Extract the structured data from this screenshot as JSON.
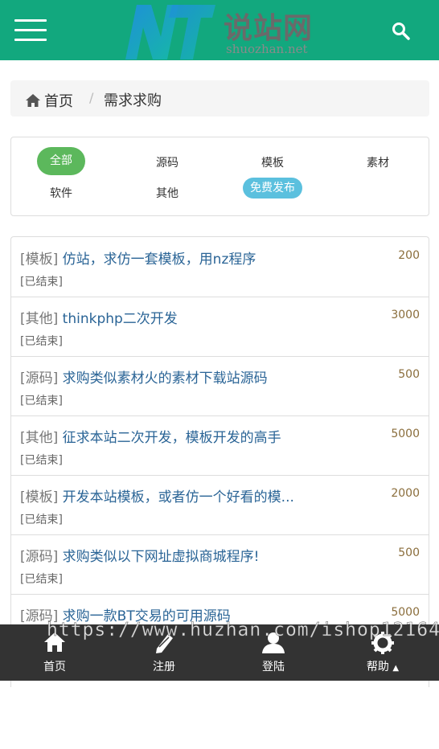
{
  "header": {
    "logo_cn": "说站网",
    "logo_url": "shuozhan.net",
    "brand_color": "#12a87e"
  },
  "breadcrumb": {
    "home": "首页",
    "separator": "/",
    "current": "需求求购"
  },
  "categories": {
    "items": [
      "全部",
      "源码",
      "模板",
      "素材",
      "软件",
      "其他"
    ],
    "publish": "免费发布"
  },
  "demands": [
    {
      "cat": "[模板]",
      "title": "仿站，求仿一套模板，用nz程序",
      "status": "[已结束]",
      "price": "200"
    },
    {
      "cat": "[其他]",
      "title": "thinkphp二次开发",
      "status": "[已结束]",
      "price": "3000"
    },
    {
      "cat": "[源码]",
      "title": "求购类似素材火的素材下载站源码",
      "status": "[已结束]",
      "price": "500"
    },
    {
      "cat": "[其他]",
      "title": "征求本站二次开发，模板开发的高手",
      "status": "[已结束]",
      "price": "5000"
    },
    {
      "cat": "[模板]",
      "title": "开发本站模板，或者仿一个好看的模...",
      "status": "[已结束]",
      "price": "2000"
    },
    {
      "cat": "[源码]",
      "title": "求购类似以下网址虚拟商城程序!",
      "status": "[已结束]",
      "price": "500"
    },
    {
      "cat": "[源码]",
      "title": "求购一款BT交易的可用源码",
      "status": "",
      "price": "5000"
    }
  ],
  "bottom_nav": {
    "home": "首页",
    "register": "注册",
    "login": "登陆",
    "help": "帮助"
  },
  "watermark": "https://www.huzhan.com/ishop12164"
}
